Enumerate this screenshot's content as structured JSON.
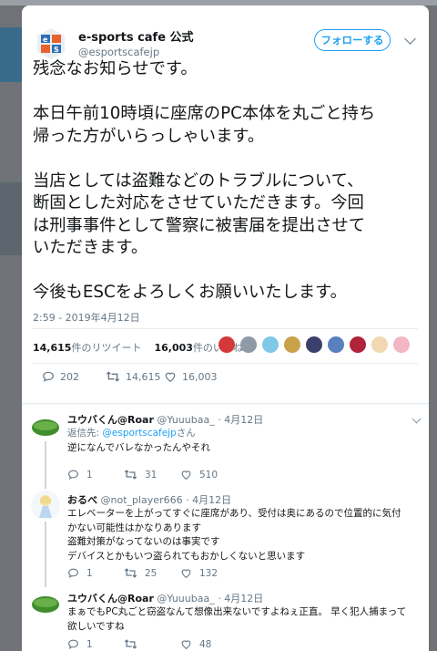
{
  "tweet": {
    "account_name": "e-sports cafe 公式",
    "account_handle": "@esportscafejp",
    "follow_label": "フォローする",
    "paragraphs": [
      [
        "残念なお知らせです。"
      ],
      [
        "本日午前10時頃に座席のPC本体を丸ごと持ち",
        "帰った方がいらっしゃいます。"
      ],
      [
        "当店としては盗難などのトラブルについて、",
        "断固とした対応をさせていただきます。今回",
        "は刑事事件として警察に被害届を提出させて",
        "いただきます。"
      ],
      [
        "今後もESCをよろしくお願いいたします。"
      ]
    ],
    "timestamp": "2:59 - 2019年4月12日",
    "retweets_count": "14,615",
    "retweets_suffix": "件のリツイート",
    "likes_count": "16,003",
    "likes_suffix": "件のいいね",
    "actions": {
      "reply": "202",
      "retweet": "14,615",
      "like": "16,003"
    },
    "liker_avatar_colors": [
      "#d23a3a",
      "#8e9aa5",
      "#7fc8e8",
      "#c9a24a",
      "#3b3f6b",
      "#5a7fbf",
      "#b0233a",
      "#f2d7b0",
      "#f3b6c4"
    ]
  },
  "replies": [
    {
      "name": "ユウバくん@Roar",
      "handle": "@Yuuubaa_",
      "date": "· 4月12日",
      "reply_to_prefix": "返信先: ",
      "reply_to_handle": "@esportscafejp",
      "reply_to_suffix": "さん",
      "lines": [
        "逆になんでバレなかったんやそれ"
      ],
      "counts": {
        "reply": "1",
        "retweet": "31",
        "like": "510"
      }
    },
    {
      "name": "おるべ",
      "handle": "@not_player666",
      "date": "· 4月12日",
      "lines": [
        "エレベーターを上がってすぐに座席があり、受付は奥にあるので位置的に気付",
        "かない可能性はかなりあります",
        "盗難対策がなってないのは事実です",
        "デバイスとかもいつ盗られてもおかしくないと思います"
      ],
      "counts": {
        "reply": "1",
        "retweet": "25",
        "like": "132"
      }
    },
    {
      "name": "ユウバくん@Roar",
      "handle": "@Yuuubaa_",
      "date": "· 4月12日",
      "lines": [
        "まぁでもPC丸ごと窃盗なんて想像出来ないですよねぇ正直。 早く犯人捕まって",
        "欲しいですね"
      ],
      "counts": {
        "reply": "1",
        "retweet": "",
        "like": "48"
      }
    }
  ],
  "icons": {
    "reply": "reply-icon",
    "retweet": "retweet-icon",
    "like": "heart-icon",
    "more": "chevron-down-icon"
  },
  "colors": {
    "accent": "#1da1f2",
    "secondary_text": "#657786",
    "divider": "#e6ecf0"
  }
}
